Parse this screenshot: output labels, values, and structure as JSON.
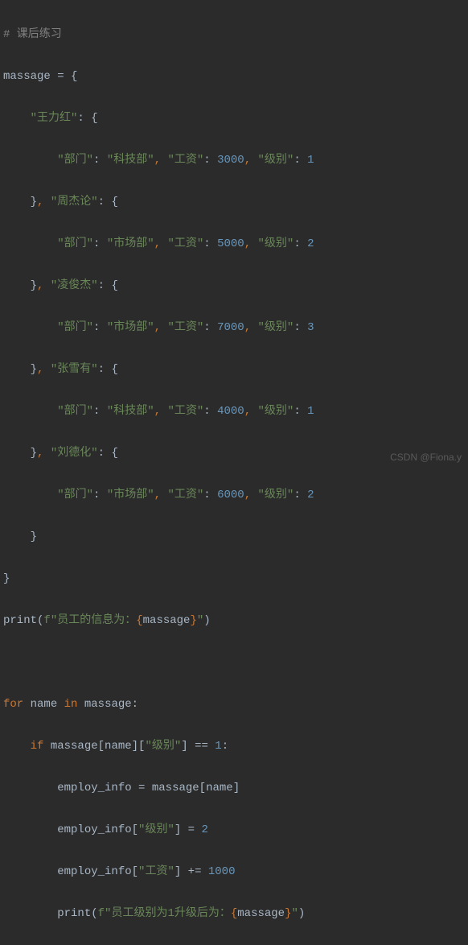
{
  "comment": "# 课后练习",
  "var_name": "massage",
  "equals": " = ",
  "employees": [
    {
      "name": "王力红",
      "dept": "科技部",
      "salary": "3000",
      "level": "1"
    },
    {
      "name": "周杰论",
      "dept": "市场部",
      "salary": "5000",
      "level": "2"
    },
    {
      "name": "凌俊杰",
      "dept": "市场部",
      "salary": "7000",
      "level": "3"
    },
    {
      "name": "张雪有",
      "dept": "科技部",
      "salary": "4000",
      "level": "1"
    },
    {
      "name": "刘德化",
      "dept": "市场部",
      "salary": "6000",
      "level": "2"
    }
  ],
  "key_dept": "\"部门\"",
  "key_salary": "\"工资\"",
  "key_level": "\"级别\"",
  "print1_prefix": "f\"员工的信息为：",
  "print1_var": "massage",
  "loop": {
    "for": "for",
    "name": "name",
    "in": "in",
    "coll": "massage"
  },
  "if_line": {
    "if": "if",
    "expr1": "massage",
    "bracket1": "[",
    "var1": "name",
    "bracket2": "][",
    "key": "\"级别\"",
    "bracket3": "]",
    "eq": " == ",
    "val": "1"
  },
  "assign1": {
    "lhs": "employ_info",
    "eq": " = ",
    "rhs1": "massage",
    "br1": "[",
    "rhs2": "name",
    "br2": "]"
  },
  "assign2": {
    "lhs": "employ_info",
    "br1": "[",
    "key": "\"级别\"",
    "br2": "]",
    "eq": " = ",
    "val": "2"
  },
  "assign3": {
    "lhs": "employ_info",
    "br1": "[",
    "key": "\"工资\"",
    "br2": "]",
    "eq": " += ",
    "val": "1000"
  },
  "print2_prefix": "f\"员工级别为1升级后为：",
  "print2_var": "massage",
  "watermark": "CSDN @Fiona.y"
}
